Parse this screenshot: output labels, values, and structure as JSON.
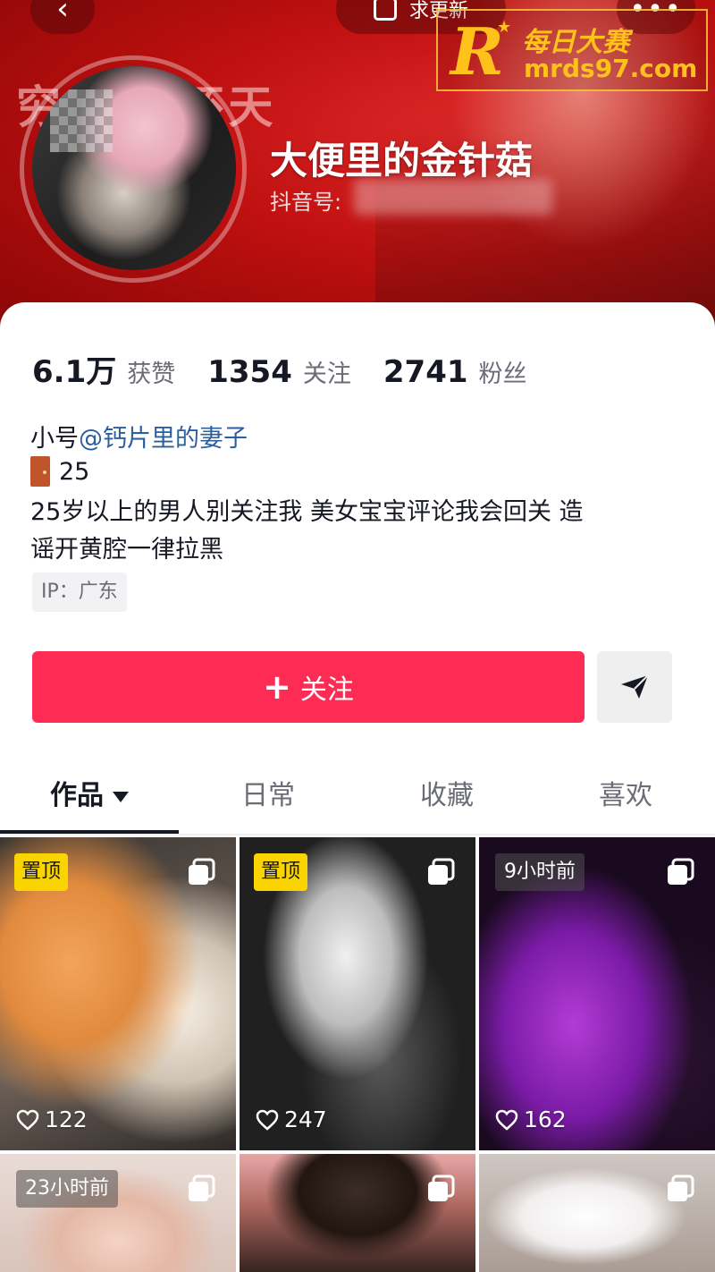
{
  "header": {
    "back_icon": "back-arrow-icon",
    "update_label": "求更新",
    "more_icon": "more-dots-icon",
    "background_text": "穷  逼样还天",
    "nickname": "大便里的金针菇",
    "douyin_id_label": "抖音号:"
  },
  "watermark": {
    "logo_letter": "R",
    "title": "每日大赛",
    "url": "mrds97.com"
  },
  "stats": [
    {
      "value": "6.1万",
      "label": "获赞"
    },
    {
      "value": "1354",
      "label": "关注"
    },
    {
      "value": "2741",
      "label": "粉丝"
    }
  ],
  "bio": {
    "line1_prefix": "小号",
    "line1_mention": "@钙片里的妻子",
    "line2": "25",
    "line3": "25岁以上的男人别关注我 美女宝宝评论我会回关 造",
    "line4": "谣开黄腔一律拉黑",
    "ip": "IP：广东"
  },
  "actions": {
    "follow_plus": "+",
    "follow_label": "关注",
    "share_icon": "send-arrow-icon"
  },
  "tabs": [
    {
      "label": "作品",
      "active": true
    },
    {
      "label": "日常",
      "active": false
    },
    {
      "label": "收藏",
      "active": false
    },
    {
      "label": "喜欢",
      "active": false
    }
  ],
  "videos": [
    {
      "badge": "置顶",
      "badge_type": "pinned",
      "likes": "122"
    },
    {
      "badge": "置顶",
      "badge_type": "pinned",
      "likes": "247"
    },
    {
      "badge": "9小时前",
      "badge_type": "time",
      "likes": "162"
    },
    {
      "badge": "23小时前",
      "badge_type": "time",
      "likes": ""
    },
    {
      "badge": "",
      "badge_type": "none",
      "likes": ""
    },
    {
      "badge": "",
      "badge_type": "none",
      "likes": ""
    }
  ],
  "colors": {
    "accent": "#fe2c55",
    "pin_badge": "#fad400",
    "banner": "#c01010",
    "mention": "#2b5f9e"
  }
}
